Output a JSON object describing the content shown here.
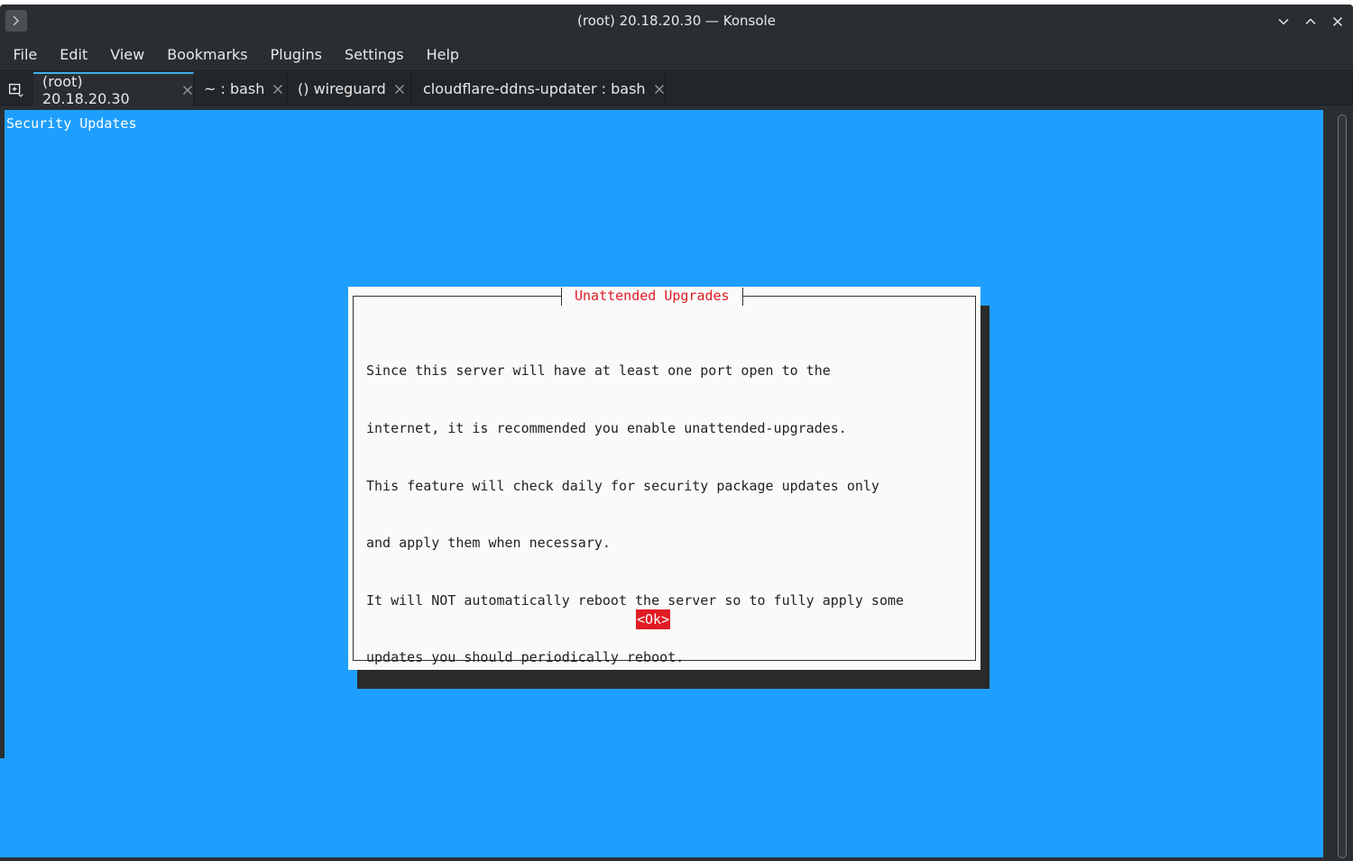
{
  "window": {
    "title": "(root) 20.18.20.30 — Konsole",
    "app_icon": "terminal-prompt-icon",
    "controls": [
      "minimize-icon",
      "maximize-icon",
      "close-icon"
    ]
  },
  "menubar": {
    "items": [
      "File",
      "Edit",
      "View",
      "Bookmarks",
      "Plugins",
      "Settings",
      "Help"
    ]
  },
  "tabs": [
    {
      "label": "(root) 20.18.20.30",
      "active": true
    },
    {
      "label": "~ : bash",
      "active": false
    },
    {
      "label": "() wireguard",
      "active": false
    },
    {
      "label": "cloudflare-ddns-updater : bash",
      "active": false
    }
  ],
  "terminal": {
    "background": "#1e9ffe",
    "backtitle": "Security Updates",
    "dialog": {
      "title": "Unattended Upgrades",
      "body_lines": [
        "Since this server will have at least one port open to the",
        "internet, it is recommended you enable unattended-upgrades.",
        "This feature will check daily for security package updates only",
        "and apply them when necessary.",
        "It will NOT automatically reboot the server so to fully apply some",
        "updates you should periodically reboot."
      ],
      "ok_label": "<Ok>",
      "accent": "#e01b24"
    }
  }
}
